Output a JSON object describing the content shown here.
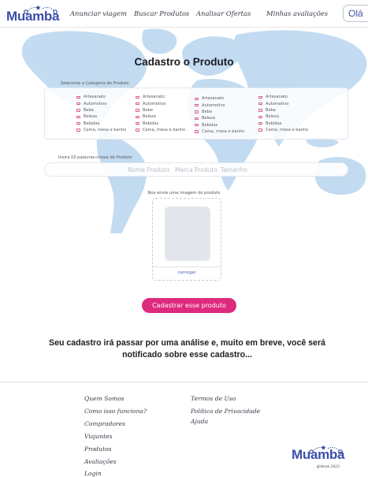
{
  "header": {
    "logo_text": "Muamba",
    "nav": [
      {
        "label": "Anunciar viagem"
      },
      {
        "label": "Buscar Produtos"
      },
      {
        "label": "Analisar Ofertas"
      },
      {
        "label": "Minhas avaliações"
      }
    ],
    "greeting": "Olá"
  },
  "form": {
    "title": "Cadastro o Produto",
    "category_label": "Selecione a Categoria do Produto",
    "category_columns": [
      [
        "Artesanato",
        "Automotivo",
        "Bebe",
        "Beleza",
        "Bebidas",
        "Cama, mesa e banho"
      ],
      [
        "Artesanato",
        "Automotivo",
        "Bebe",
        "Beleza",
        "Bebidas",
        "Cama, mesa e banho"
      ],
      [
        "Artesanato",
        "Automotivo",
        "Bebe",
        "Beleza",
        "Bebidas",
        "Cama, mesa e banho"
      ],
      [
        "Artesanato",
        "Automotivo",
        "Bebe",
        "Beleza",
        "Bebidas",
        "Cama, mesa e banho"
      ]
    ],
    "keywords_label": "Insira 10 palavras-chave do Produto",
    "keyword_placeholders": [
      "Nome Produto",
      "Marca Produto",
      "Tamanho"
    ],
    "image_label": "Nos envie uma imagem do produto",
    "upload_label": "carregar",
    "submit_label": "Cadastrar esse produto",
    "notice": "Seu cadastro irá passar por uma análise e, muito em breve, você será notificado sobre esse cadastro..."
  },
  "footer": {
    "links_col1": [
      "Quem Somos",
      "Como isso funciona?",
      "Compradores",
      "Viajantes",
      "Produtos",
      "Avaliações",
      "Login"
    ],
    "links_col2": [
      "Termos de Uso",
      "Política de Privacidade",
      "Ajuda"
    ],
    "logo_text": "Muamba",
    "copyright": "@move 2023"
  },
  "colors": {
    "brand_blue": "#3b4fa8",
    "accent_pink": "#de2a7d",
    "map_blue": "#bcd8ef"
  },
  "icons": {
    "logo_route": "route-pins-icon",
    "checkbox": "checkbox-icon"
  }
}
